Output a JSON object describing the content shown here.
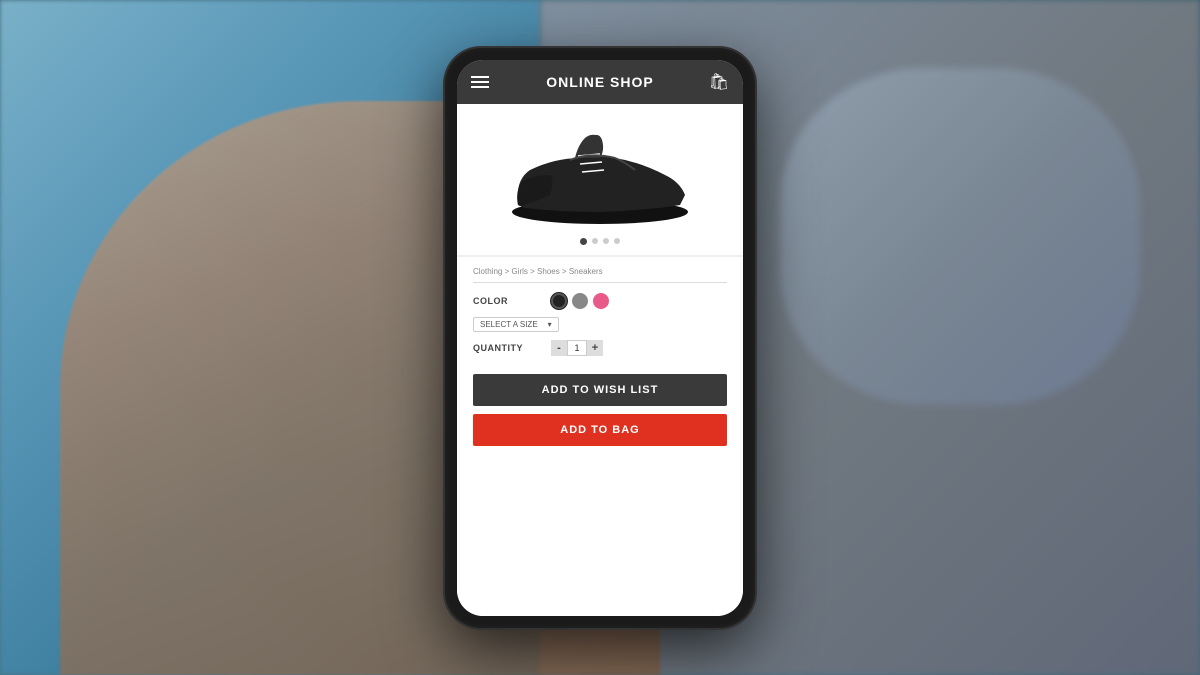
{
  "background": {
    "color": "#5a8a9a"
  },
  "app": {
    "title": "ONLINE SHOP"
  },
  "topbar": {
    "title": "ONLINE SHOP",
    "menu_label": "menu",
    "bag_label": "bag"
  },
  "product": {
    "breadcrumb": "Clothing > Girls > Shoes > Sneakers",
    "color_label": "COLOR",
    "colors": [
      {
        "name": "black",
        "hex": "#222222"
      },
      {
        "name": "gray",
        "hex": "#888888"
      },
      {
        "name": "pink",
        "hex": "#e85a8a"
      }
    ],
    "size_label": "SELECT A SIZE",
    "size_placeholder": "SELECT A SIZE",
    "quantity_label": "QUANTITY",
    "quantity": "1",
    "qty_minus": "-",
    "qty_plus": "+",
    "carousel_dots": [
      {
        "active": true
      },
      {
        "active": false
      },
      {
        "active": false
      },
      {
        "active": false
      }
    ]
  },
  "buttons": {
    "wishlist_label": "ADD TO WISH LIST",
    "bag_label": "ADD TO BAG"
  }
}
